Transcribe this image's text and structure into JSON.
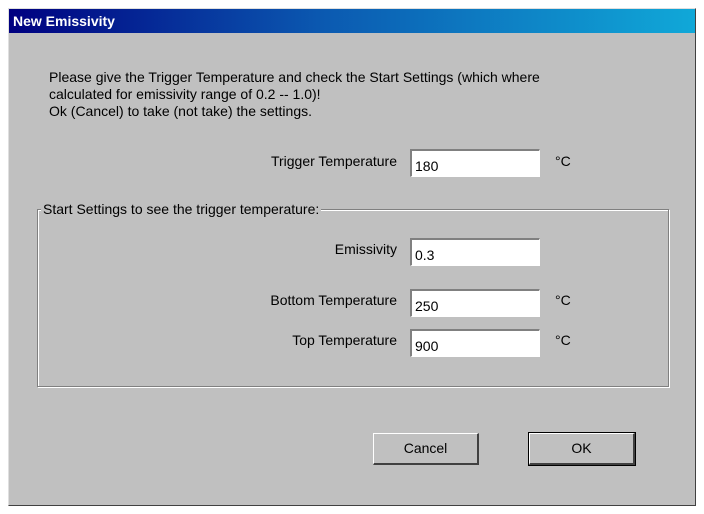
{
  "window": {
    "title": "New Emissivity"
  },
  "message": "Please give the Trigger Temperature and check the Start Settings (which where\ncalculated for emissivity range of 0.2 -- 1.0)!\nOk (Cancel) to take (not take) the settings.",
  "trigger": {
    "label": "Trigger Temperature",
    "value": "180",
    "unit": "°C"
  },
  "start_settings": {
    "title": "Start Settings to see the trigger temperature:",
    "emissivity": {
      "label": "Emissivity",
      "value": "0.3"
    },
    "bottom": {
      "label": "Bottom Temperature",
      "value": "250",
      "unit": "°C"
    },
    "top": {
      "label": "Top Temperature",
      "value": "900",
      "unit": "°C"
    }
  },
  "buttons": {
    "cancel": "Cancel",
    "ok": "OK"
  }
}
